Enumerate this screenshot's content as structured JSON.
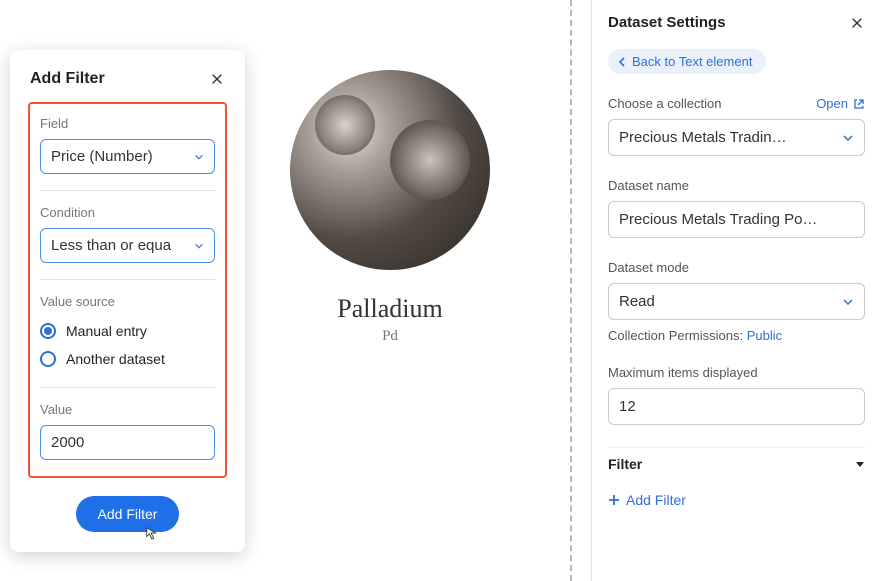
{
  "addFilter": {
    "title": "Add Filter",
    "fieldLabel": "Field",
    "fieldValue": "Price (Number)",
    "conditionLabel": "Condition",
    "conditionValue": "Less than or equa",
    "valueSourceLabel": "Value source",
    "radioManual": "Manual entry",
    "radioAnother": "Another dataset",
    "valueLabel": "Value",
    "valueInput": "2000",
    "submitButton": "Add Filter"
  },
  "item": {
    "title": "Palladium",
    "subtitle": "Pd"
  },
  "settings": {
    "title": "Dataset Settings",
    "backLink": "Back to Text element",
    "collectionLabel": "Choose a collection",
    "openLabel": "Open",
    "collectionValue": "Precious Metals Tradin…",
    "datasetNameLabel": "Dataset name",
    "datasetNameValue": "Precious Metals Trading Por…",
    "modeLabel": "Dataset mode",
    "modeValue": "Read",
    "permissionsLabel": "Collection Permissions: ",
    "permissionsValue": "Public",
    "maxItemsLabel": "Maximum items displayed",
    "maxItemsValue": "12",
    "filterSection": "Filter",
    "addFilterLink": "Add Filter"
  }
}
